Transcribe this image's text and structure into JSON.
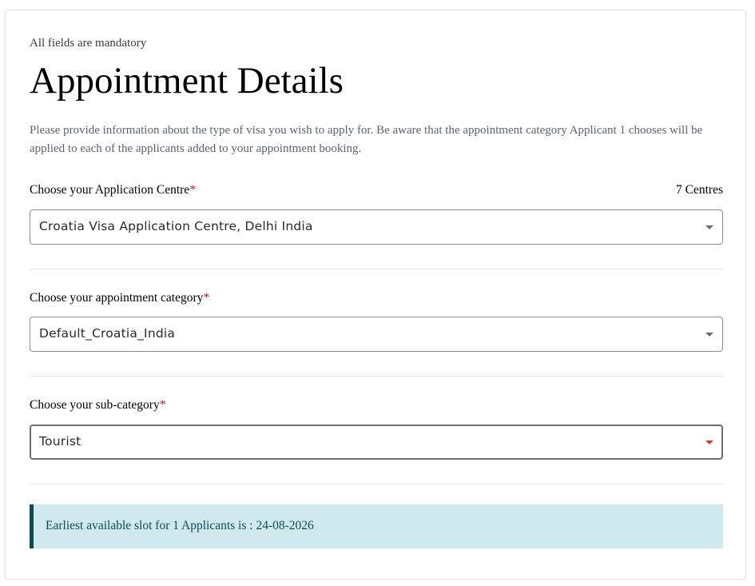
{
  "form": {
    "mandatory_note": "All fields are mandatory",
    "title": "Appointment Details",
    "intro": "Please provide information about the type of visa you wish to apply for. Be aware that the appointment category Applicant 1 chooses will be applied to each of the applicants added to your appointment booking.",
    "required_marker": "*"
  },
  "application_centre": {
    "label": "Choose your Application Centre",
    "count_text": "7 Centres",
    "value": "Croatia Visa Application Centre, Delhi India",
    "icon": "chevron-down-icon"
  },
  "appointment_category": {
    "label": "Choose your appointment category",
    "value": "Default_Croatia_India",
    "icon": "chevron-down-icon"
  },
  "sub_category": {
    "label": "Choose your sub-category",
    "value": "Tourist",
    "icon": "chevron-down-icon",
    "active_caret_color": "#c0472a"
  },
  "slot_notice": {
    "text": "Earliest available slot for 1 Applicants is : 24-08-2026",
    "background_color": "#d0e9ee",
    "accent_color": "#0e4a55"
  }
}
